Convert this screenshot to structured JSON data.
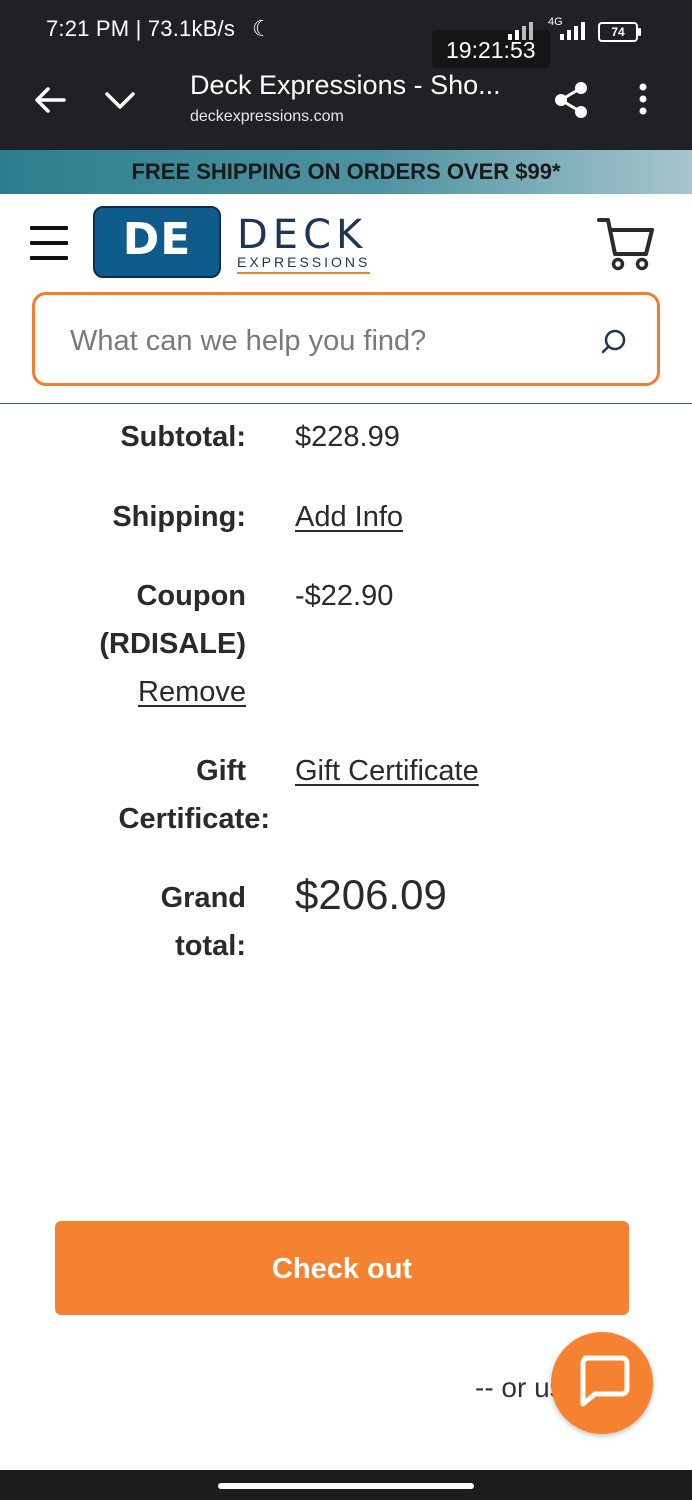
{
  "status_bar": {
    "left_text": "7:21 PM | 73.1kB/s",
    "clock_overlay": "19:21:53",
    "network": "4G",
    "battery": "74"
  },
  "browser": {
    "title": "Deck Expressions - Sho...",
    "url": "deckexpressions.com"
  },
  "promo_banner": "FREE SHIPPING ON ORDERS OVER $99*",
  "logo": {
    "badge": "DE",
    "word": "DECK",
    "sub": "EXPRESSIONS"
  },
  "search": {
    "placeholder": "What can we help you find?"
  },
  "totals": {
    "subtotal_label": "Subtotal:",
    "subtotal_value": "$228.99",
    "shipping_label": "Shipping:",
    "shipping_link": "Add Info",
    "coupon_label_line1": "Coupon",
    "coupon_label_line2": "(RDISALE)",
    "coupon_remove": "Remove",
    "coupon_value": "-$22.90",
    "gift_label_line1": "Gift",
    "gift_label_line2": "Certificate:",
    "gift_link": "Gift Certificate",
    "grand_label_line1": "Grand",
    "grand_label_line2": "total:",
    "grand_value": "$206.09"
  },
  "checkout": {
    "button_label": "Check out",
    "alt_text": "-- or us"
  },
  "colors": {
    "accent": "#f58230",
    "brand_navy": "#1f3556",
    "brand_blue": "#0f5c8c"
  }
}
